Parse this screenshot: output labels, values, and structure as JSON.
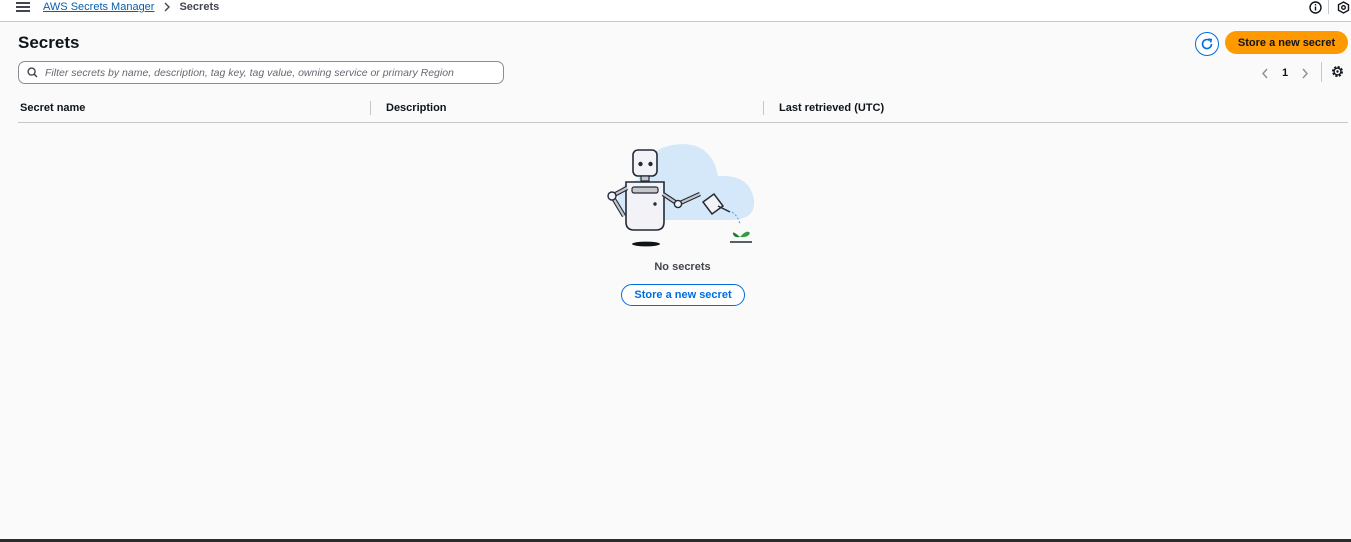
{
  "breadcrumb": {
    "service_link": "AWS Secrets Manager",
    "current": "Secrets"
  },
  "header": {
    "title": "Secrets",
    "store_button_label": "Store a new secret"
  },
  "filter": {
    "placeholder": "Filter secrets by name, description, tag key, tag value, owning service or primary Region",
    "value": ""
  },
  "pagination": {
    "current_page": "1"
  },
  "table": {
    "columns": [
      "Secret name",
      "Description",
      "Last retrieved (UTC)"
    ],
    "rows": []
  },
  "empty_state": {
    "message": "No secrets",
    "button_label": "Store a new secret"
  },
  "icons": {
    "menu": "hamburger-icon",
    "breadcrumb_separator": "chevron-right-icon",
    "info": "info-icon",
    "notifications": "notification-icon",
    "refresh": "refresh-icon",
    "search": "search-icon",
    "prev": "chevron-left-icon",
    "next": "chevron-right-icon",
    "settings": "gear-icon"
  },
  "colors": {
    "primary_button": "#ff9900",
    "link": "#0b5ea8",
    "accent_blue": "#006ce0",
    "background": "#fafafa"
  }
}
